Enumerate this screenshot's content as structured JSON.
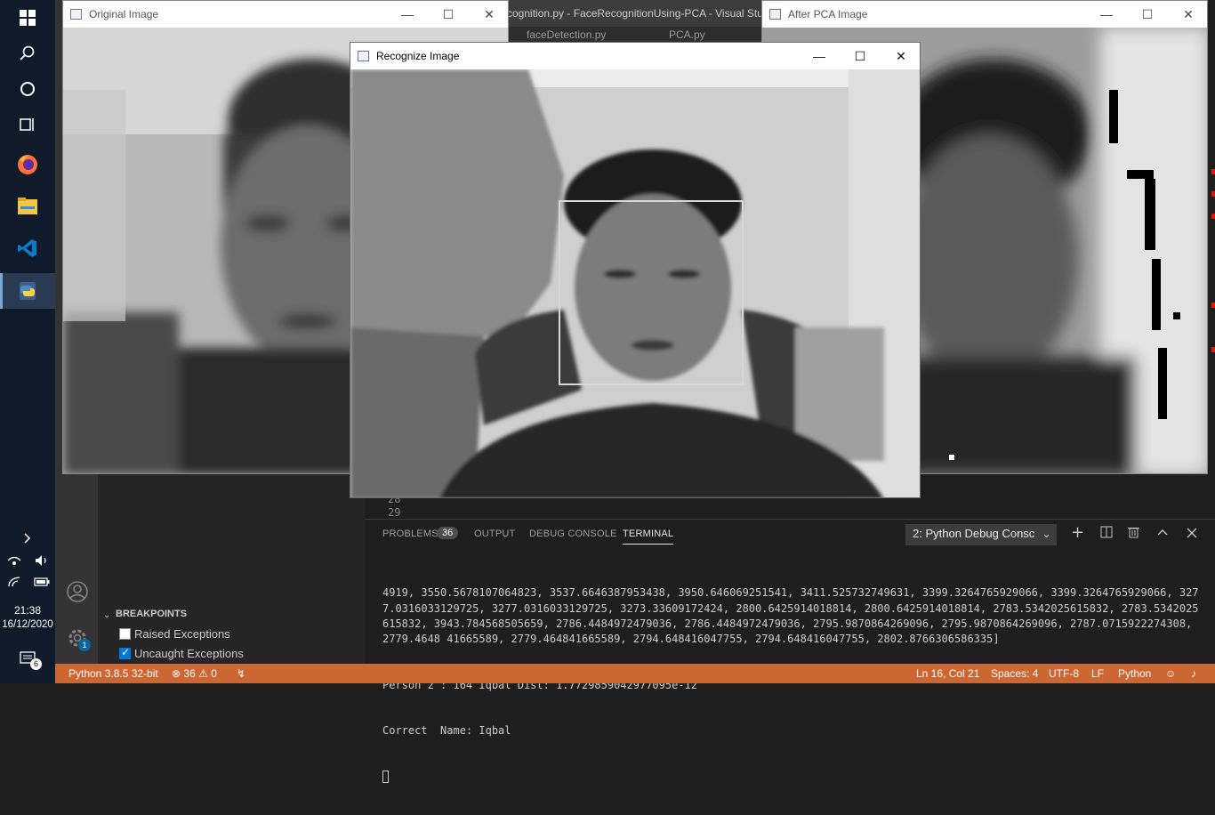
{
  "taskbar": {
    "icons": [
      "windows-start-icon",
      "search-icon",
      "cortana-icon",
      "task-view-icon",
      "firefox-icon",
      "file-explorer-icon",
      "vscode-icon",
      "python-icon"
    ],
    "tray": {
      "time": "21:38",
      "date": "16/12/2020",
      "notification_count": "6"
    }
  },
  "vscode": {
    "title": "cognition.py - FaceRecognitionUsing-PCA - Visual Stu",
    "tabs": [
      "faceDetection.py",
      "PCA.py"
    ],
    "line_numbers": [
      "28",
      "29"
    ],
    "activity": {
      "settings_badge": "1"
    },
    "breakpoints": {
      "header": "BREAKPOINTS",
      "items": [
        {
          "label": "Raised Exceptions",
          "checked": false
        },
        {
          "label": "Uncaught Exceptions",
          "checked": true
        }
      ]
    },
    "panel": {
      "tabs": [
        "PROBLEMS",
        "OUTPUT",
        "DEBUG CONSOLE",
        "TERMINAL"
      ],
      "problems_count": "36",
      "active_tab": "TERMINAL",
      "terminal_select": "2: Python Debug Consc",
      "terminal_lines": [
        "4919, 3550.5678107064823, 3537.6646387953438, 3950.646069251541, 3411.525732749631, 3399.3264765929066, 3399.3264765929066, 3277.0316033129725, 3277.0316033129725, 3273.33609172424, 2800.6425914018814, 2800.6425914018814, 2783.5342025615832, 2783.5342025615832, 3943.784568505659, 2786.4484972479036, 2786.4484972479036, 2795.9870864269096, 2795.9870864269096, 2787.0715922274308, 2779.4648 41665589, 2779.464841665589, 2794.648416047755, 2794.648416047755, 2802.8766306586335]",
        "Person 2 : 164 Iqbal Dist: 1.7729859042977095e-12",
        "Correct  Name: Iqbal"
      ]
    },
    "status": {
      "python": "Python 3.8.5 32-bit",
      "errors": "36",
      "warnings": "0",
      "position": "Ln 16, Col 21",
      "spaces": "Spaces: 4",
      "encoding": "UTF-8",
      "eol": "LF",
      "language": "Python",
      "bar_color": "#cc6633"
    }
  },
  "windows": {
    "original": {
      "title": "Original Image"
    },
    "recognize": {
      "title": "Recognize Image"
    },
    "after_pca": {
      "title": "After PCA Image"
    }
  }
}
